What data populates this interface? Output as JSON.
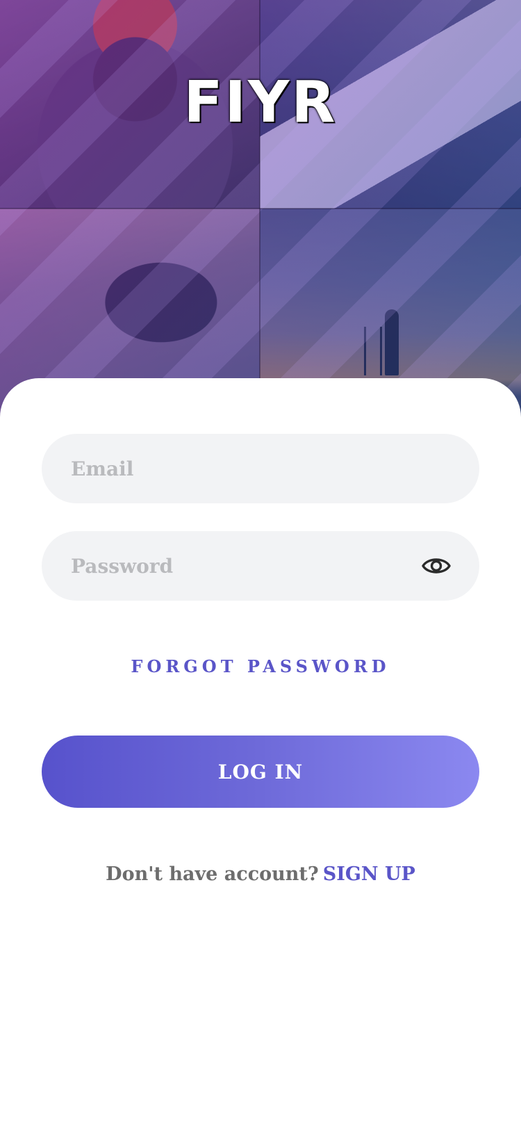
{
  "app": {
    "logo_text": "FIYR"
  },
  "login_form": {
    "email_placeholder": "Email",
    "email_value": "",
    "password_placeholder": "Password",
    "password_value": "",
    "forgot_password_label": "FORGOT PASSWORD",
    "login_button_label": "LOG IN",
    "signup_prompt": "Don't have account?",
    "signup_link_label": "SIGN UP"
  },
  "icons": {
    "password_toggle": "eye-icon"
  },
  "colors": {
    "accent": "#5a55c8",
    "button_gradient_start": "#5752cc",
    "button_gradient_end": "#8b88f0",
    "field_background": "#f2f3f5",
    "placeholder": "#b9babd",
    "muted_text": "#6d6d6d"
  }
}
